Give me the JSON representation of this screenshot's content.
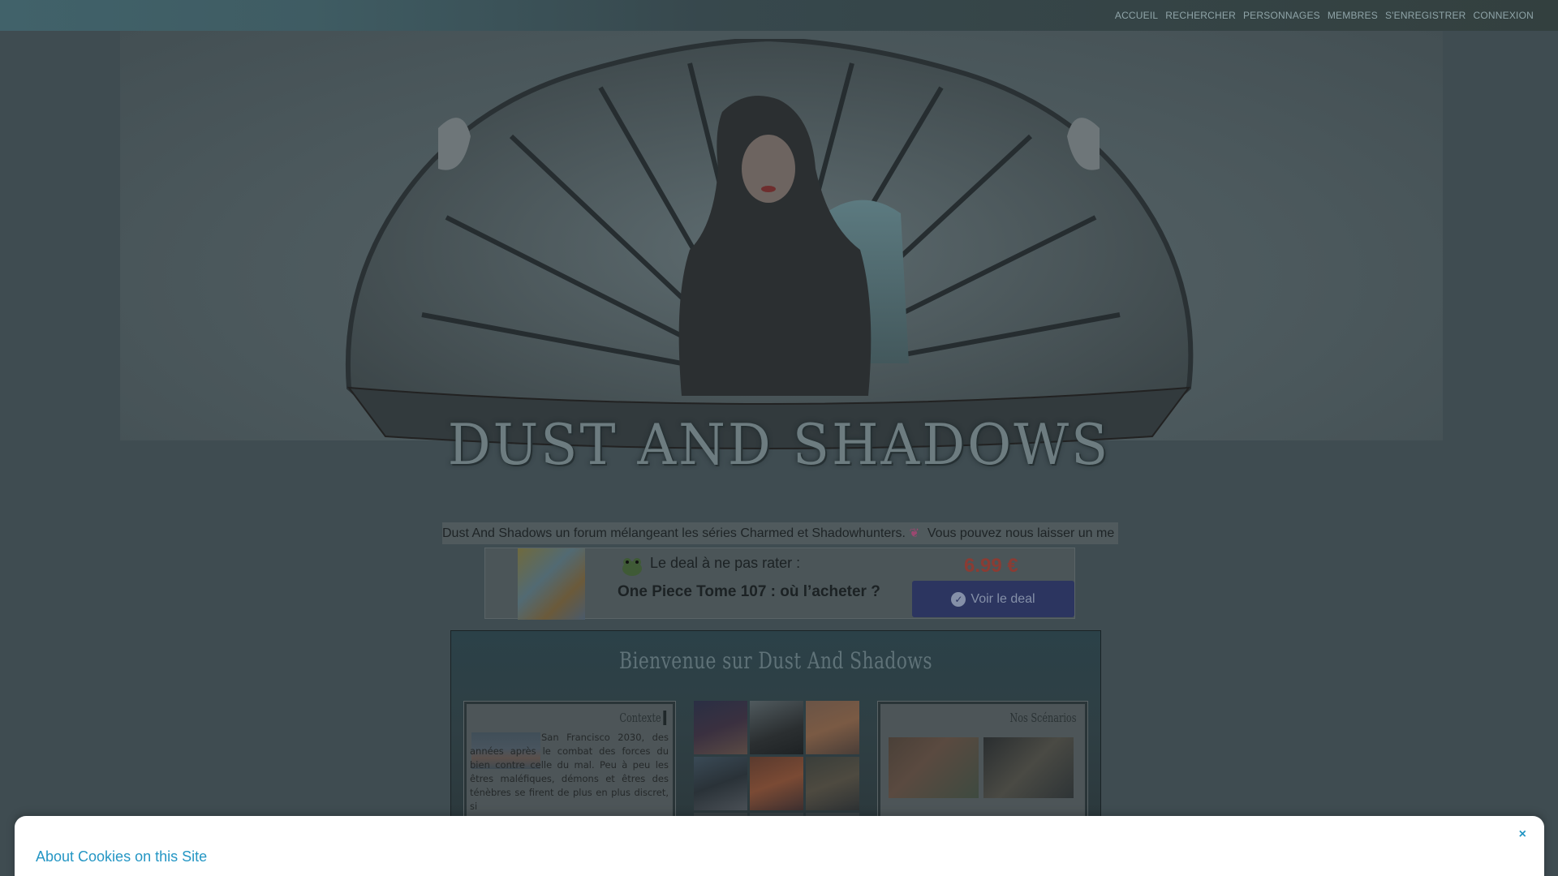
{
  "nav": {
    "items": [
      "ACCUEIL",
      "RECHERCHER",
      "PERSONNAGES",
      "MEMBRES",
      "S'ENREGISTRER",
      "CONNEXION"
    ]
  },
  "banner": {
    "logo_text": "DUST AND SHADOWS"
  },
  "marquee": {
    "text_before_icon": "Dust And Shadows un forum mélangeant les séries Charmed et Shadowhunters.",
    "icon": "heart-icon",
    "text_after_icon": "Vous pouvez nous laisser un me"
  },
  "deal": {
    "label": "Le deal à ne pas rater :",
    "title": "One Piece Tome 107 : où l’acheter ?",
    "price": "6.99 €",
    "button_label": "Voir le deal"
  },
  "welcome": {
    "title": "Bienvenue sur Dust And Shadows",
    "context": {
      "heading": "Contexte",
      "text": "San Francisco 2030, des années après le combat des forces du bien contre celle du mal. Peu à peu les êtres maléfiques, démons et êtres des ténèbres se firent de plus en plus discret, si"
    },
    "scenarios": {
      "heading": "Nos Scénarios"
    }
  },
  "cookie": {
    "title": "About Cookies on this Site",
    "close": "×"
  }
}
